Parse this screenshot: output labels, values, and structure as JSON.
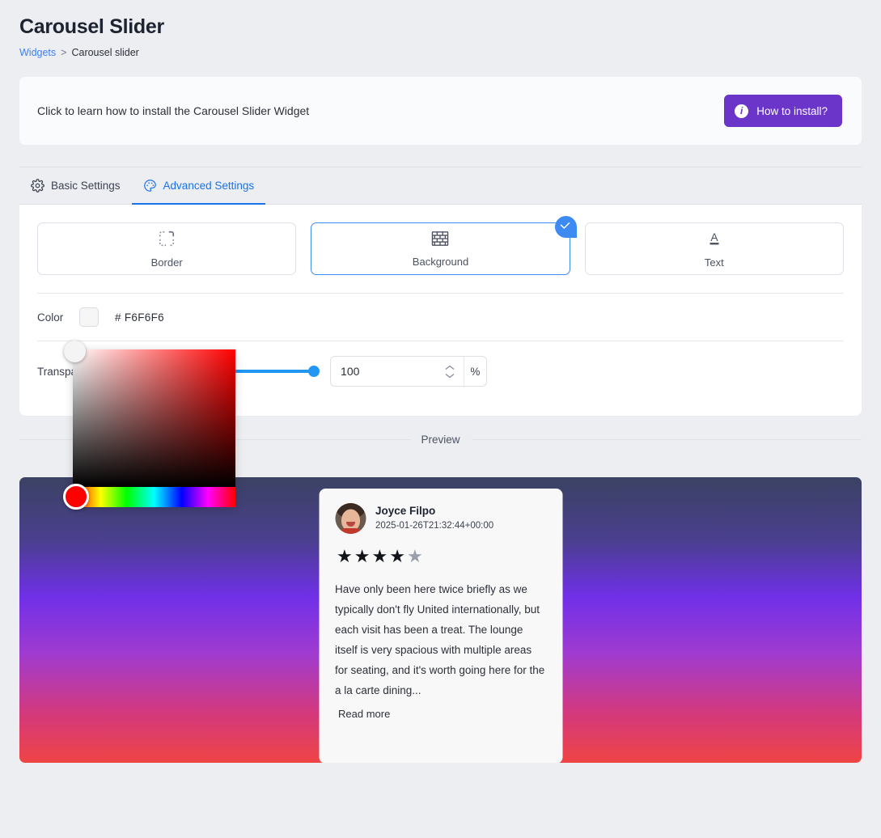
{
  "header": {
    "title": "Carousel Slider",
    "breadcrumb": {
      "parent": "Widgets",
      "separator": ">",
      "current": "Carousel slider"
    }
  },
  "banner": {
    "text": "Click to learn how to install the Carousel Slider Widget",
    "button_label": "How to install?",
    "button_icon": "info-icon",
    "button_color": "#6b35c9"
  },
  "tabs": [
    {
      "label": "Basic Settings",
      "icon": "gear-icon",
      "active": false
    },
    {
      "label": "Advanced Settings",
      "icon": "palette-icon",
      "active": true
    }
  ],
  "accent_color": "#1a73e8",
  "option_cards": [
    {
      "label": "Border",
      "icon": "dashed-border-icon",
      "selected": false
    },
    {
      "label": "Background",
      "icon": "brick-wall-icon",
      "selected": true
    },
    {
      "label": "Text",
      "icon": "text-underline-icon",
      "selected": false
    }
  ],
  "color_field": {
    "label": "Color",
    "hash": "#",
    "value": "F6F6F6",
    "swatch_color": "#F6F6F6"
  },
  "transparency_field": {
    "label": "Transparency",
    "value": "100",
    "suffix": "%",
    "slider_percent": 100,
    "slider_color": "#2196f3"
  },
  "color_picker": {
    "hue_color": "#ff0000",
    "open": true
  },
  "preview": {
    "label": "Preview",
    "gradient_stops": [
      "#3b4263",
      "#4a3f8e",
      "#7030e8",
      "#a03bcf",
      "#d2397f",
      "#ef4444"
    ]
  },
  "review": {
    "author": "Joyce Filpo",
    "date": "2025-01-26T21:32:44+00:00",
    "rating": 4,
    "max_rating": 5,
    "text": "Have only been here twice briefly as we typically don't fly United internationally, but each visit has been a treat. The lounge itself is very spacious with multiple areas for seating, and it's worth going here for the a la carte dining...",
    "read_more_label": "Read more"
  }
}
